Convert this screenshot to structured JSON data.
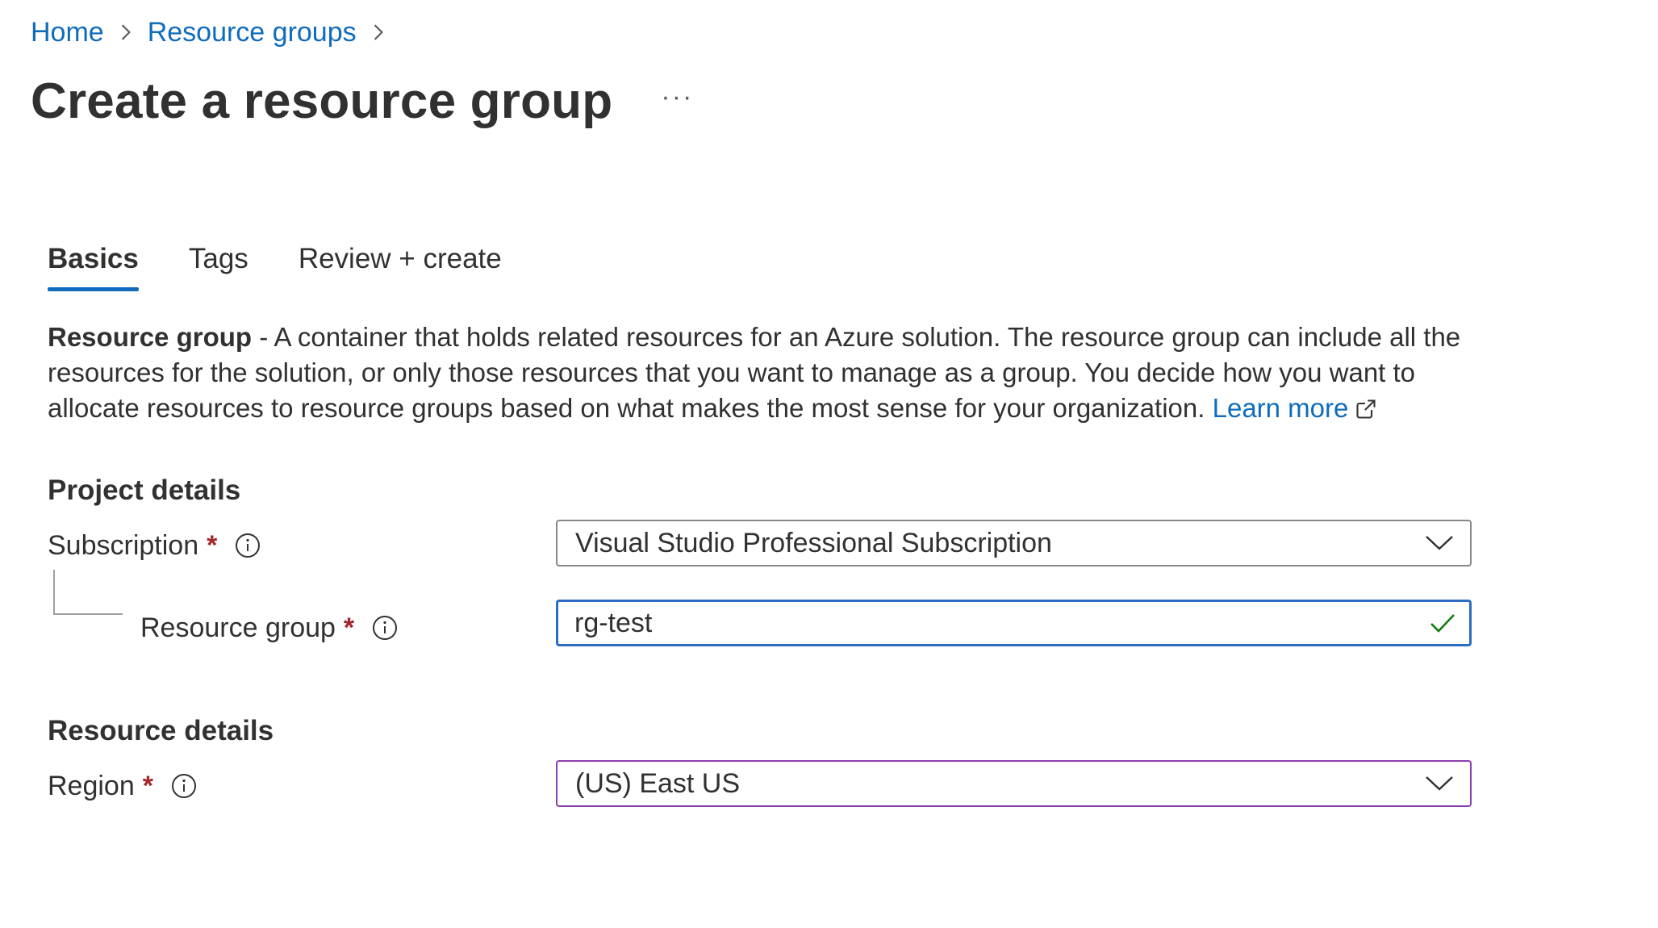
{
  "breadcrumb": {
    "items": [
      "Home",
      "Resource groups"
    ]
  },
  "header": {
    "title": "Create a resource group",
    "more_label": "···"
  },
  "tabs": [
    {
      "label": "Basics",
      "active": true
    },
    {
      "label": "Tags",
      "active": false
    },
    {
      "label": "Review + create",
      "active": false
    }
  ],
  "description": {
    "term": "Resource group",
    "text": " - A container that holds related resources for an Azure solution. The resource group can include all the resources for the solution, or only those resources that you want to manage as a group. You decide how you want to allocate resources to resource groups based on what makes the most sense for your organization. ",
    "link_label": "Learn more"
  },
  "project_details": {
    "heading": "Project details",
    "subscription": {
      "label": "Subscription",
      "required_mark": "*",
      "value": "Visual Studio Professional Subscription"
    },
    "resource_group": {
      "label": "Resource group",
      "required_mark": "*",
      "value": "rg-test"
    }
  },
  "resource_details": {
    "heading": "Resource details",
    "region": {
      "label": "Region",
      "required_mark": "*",
      "value": "(US) East US"
    }
  },
  "colors": {
    "link": "#0f6cbd",
    "focus_border": "#2b6cc4",
    "region_border": "#8a3fb0",
    "required": "#a4262c",
    "valid_check": "#107c10"
  },
  "icons": {
    "breadcrumb_separator": "chevron-right-icon",
    "info": "info-icon",
    "dropdown": "chevron-down-icon",
    "valid": "checkmark-icon",
    "external_link": "external-link-icon"
  }
}
